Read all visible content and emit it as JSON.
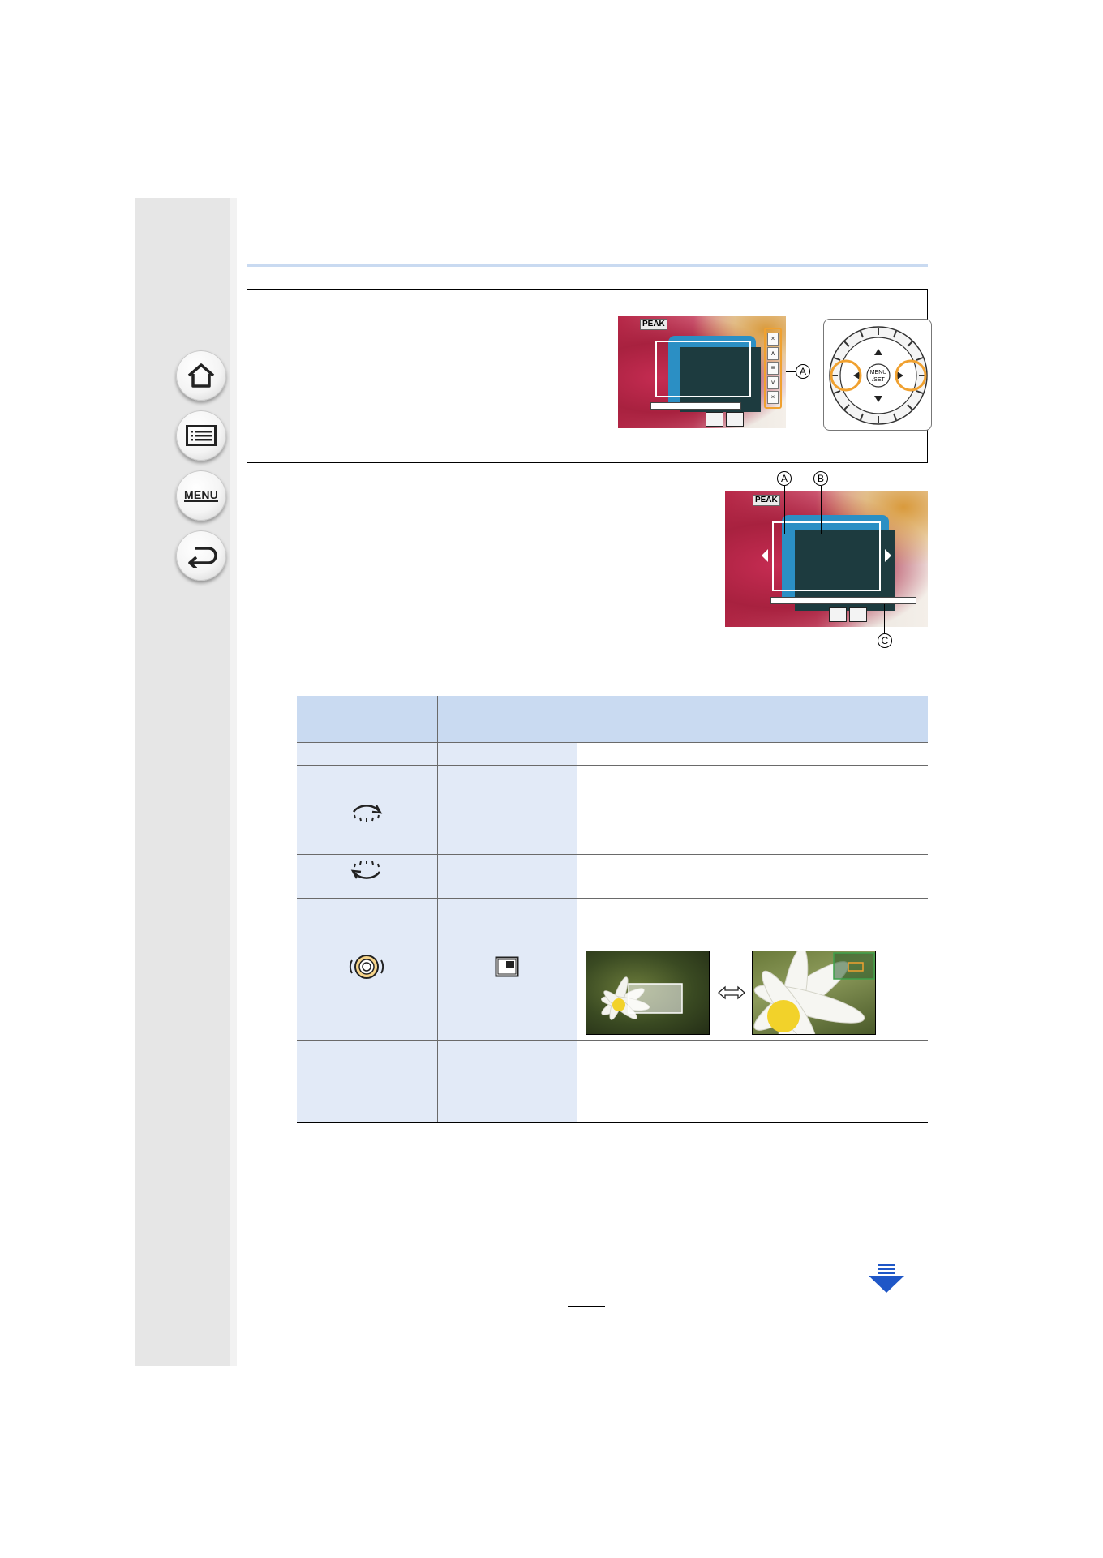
{
  "nav": {
    "home_icon": "home-icon",
    "contents_icon": "list-icon",
    "menu_label": "MENU",
    "back_icon": "back-arrow-icon"
  },
  "figure1": {
    "peak_label": "PEAK",
    "callout_a": "A"
  },
  "figure2": {
    "peak_label": "PEAK",
    "callout_a": "A",
    "callout_b": "B",
    "callout_c": "C"
  },
  "dial": {
    "center_label_1": "MENU",
    "center_label_2": "/SET"
  },
  "table": {
    "rows": [
      {
        "c1_icon": "",
        "c2_icon": ""
      },
      {
        "c1_icon": "dial-turn-right-icon",
        "c2_icon": ""
      },
      {
        "c1_icon": "dial-turn-left-icon",
        "c2_icon": ""
      },
      {
        "c1_icon": "control-dial-press-icon",
        "c2_icon": "picture-in-picture-icon"
      },
      {
        "c1_icon": "",
        "c2_icon": ""
      }
    ]
  },
  "footer": {
    "next_icon": "next-page-arrow-icon",
    "page_number": ""
  },
  "colors": {
    "accent": "#c9daf1",
    "cell_fill": "#e2eaf7",
    "highlight": "#f0a130",
    "next_arrow": "#1f57c7"
  }
}
